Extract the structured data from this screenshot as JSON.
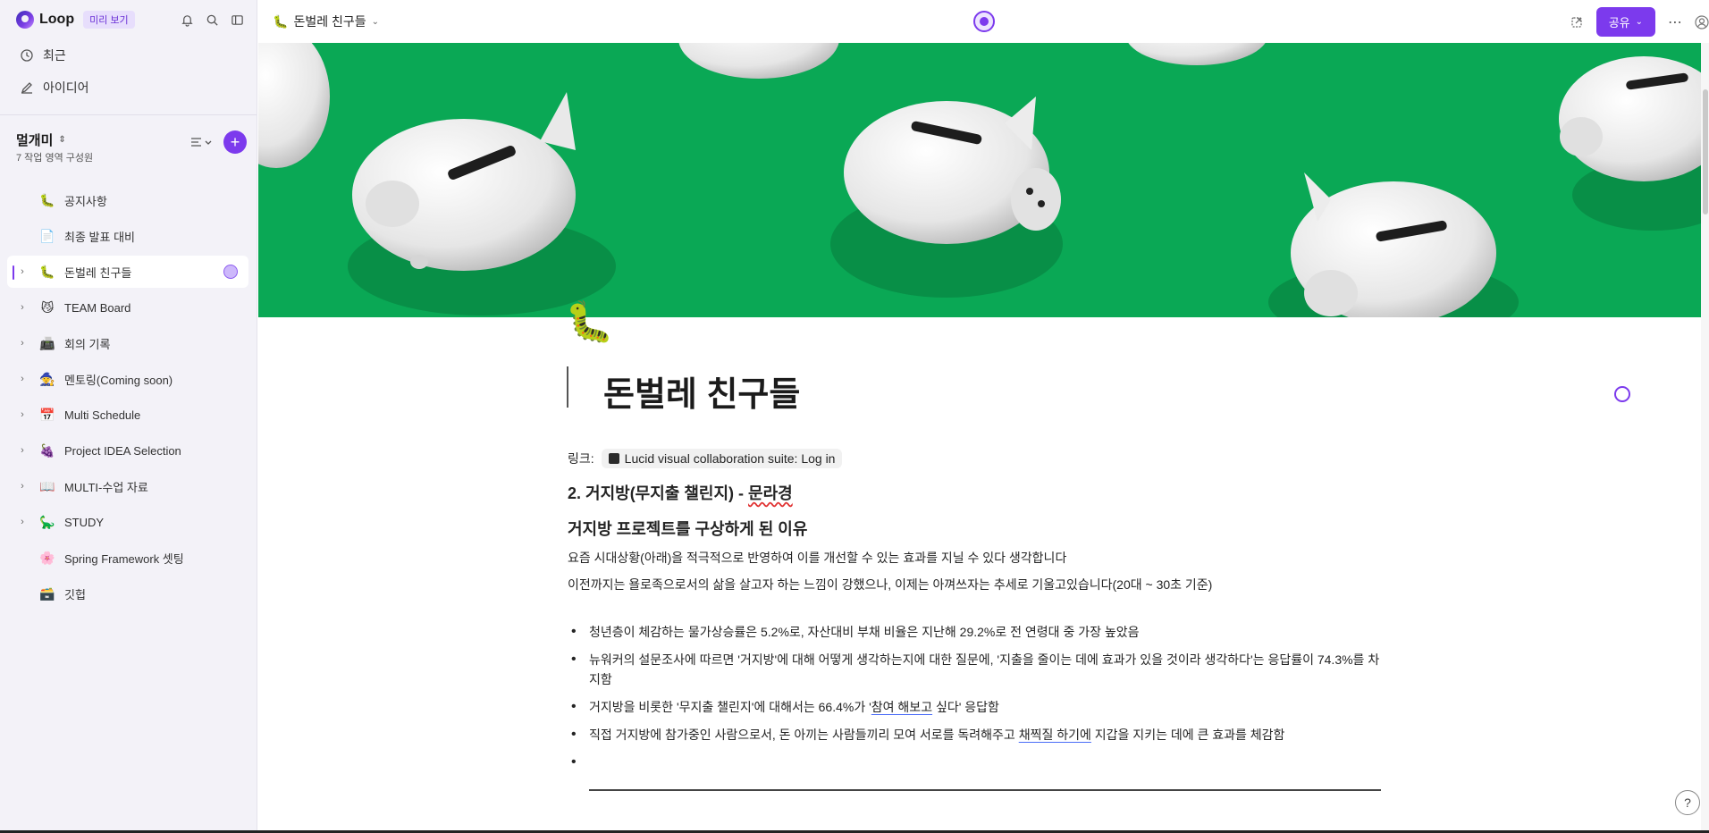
{
  "sidebar": {
    "brand": "Loop",
    "badge": "미리 보기",
    "nav": [
      {
        "label": "최근",
        "icon": "clock-icon"
      },
      {
        "label": "아이디어",
        "icon": "idea-pencil-icon"
      }
    ],
    "workspace": {
      "title": "멀개미",
      "subtitle": "7 작업 영역 구성원"
    },
    "items": [
      {
        "emoji": "🐛",
        "label": "공지사항",
        "expandable": false
      },
      {
        "emoji": "📄",
        "label": "최종 발표 대비",
        "expandable": false
      },
      {
        "emoji": "🐛",
        "label": "돈벌레 친구들",
        "expandable": true,
        "active": true
      },
      {
        "emoji": "😼",
        "label": "TEAM Board",
        "expandable": true
      },
      {
        "emoji": "📠",
        "label": "회의 기록",
        "expandable": true
      },
      {
        "emoji": "🧙",
        "label": "멘토링(Coming soon)",
        "expandable": true
      },
      {
        "emoji": "📅",
        "label": "Multi Schedule",
        "expandable": true
      },
      {
        "emoji": "🍇",
        "label": "Project IDEA Selection",
        "expandable": true
      },
      {
        "emoji": "📖",
        "label": "MULTI-수업 자료",
        "expandable": true
      },
      {
        "emoji": "🦕",
        "label": "STUDY",
        "expandable": true
      },
      {
        "emoji": "🌸",
        "label": "Spring Framework 셋팅",
        "expandable": false
      },
      {
        "emoji": "🗃️",
        "label": "깃헙",
        "expandable": false
      }
    ]
  },
  "header": {
    "emoji": "🐛",
    "title": "돈벌레 친구들",
    "share_label": "공유"
  },
  "doc": {
    "emoji": "🐛",
    "title": "돈벌레 친구들",
    "link_label": "링크:",
    "link_text": "Lucid visual collaboration suite: Log in",
    "h2_prefix": "2. 거지방(무지출 챌린지) - ",
    "h2_name": "문라경",
    "h3": "거지방 프로젝트를 구상하게 된 이유",
    "p1": "요즘 시대상황(아래)을 적극적으로 반영하여 이를 개선할 수 있는 효과를 지닐 수 있다 생각합니다",
    "p2": "이전까지는 욜로족으로서의 삶을 살고자 하는 느낌이 강했으나, 이제는 아껴쓰자는 추세로 기울고있습니다(20대 ~ 30초 기준)",
    "bullets": {
      "b1": "청년층이 체감하는 물가상승률은 5.2%로, 자산대비 부채 비율은 지난해 29.2%로 전 연령대 중 가장 높았음",
      "b2": "뉴워커의 설문조사에 따르면 '거지방'에 대해 어떻게 생각하는지에 대한 질문에, '지출을 줄이는 데에 효과가 있을 것이라 생각하다'는 응답률이 74.3%를 차지함",
      "b3_a": "거지방을 비롯한 '무지출 챌린지'에 대해서는 66.4%가 '",
      "b3_b": "참여 해보고",
      "b3_c": " 싶다' 응답함",
      "b4_a": "직접 거지방에 참가중인 사람으로서, 돈 아끼는 사람들끼리 모여 서로를 독려해주고 ",
      "b4_b": "채찍질 하기에",
      "b4_c": " 지갑을 지키는 데에 큰 효과를 체감함"
    }
  },
  "help_label": "?"
}
